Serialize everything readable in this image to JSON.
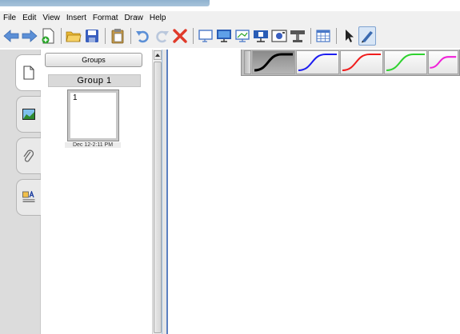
{
  "menu": {
    "items": [
      "File",
      "Edit",
      "View",
      "Insert",
      "Format",
      "Draw",
      "Help"
    ]
  },
  "toolbar": {
    "icons": [
      "back-arrow-icon",
      "forward-arrow-icon",
      "new-page-icon",
      "open-folder-icon",
      "save-icon",
      "clipboard-icon",
      "undo-icon",
      "redo-icon",
      "delete-icon",
      "screen-icon",
      "monitor-icon",
      "display-icon",
      "projector-icon",
      "camera-icon",
      "scanner-icon",
      "table-icon",
      "select-arrow-icon",
      "pen-icon"
    ]
  },
  "sidebar": {
    "tabs": [
      "page-sorter-tab",
      "gallery-tab",
      "attachments-tab",
      "properties-tab"
    ]
  },
  "panel": {
    "groups_button": "Groups",
    "group_header": "Group 1",
    "thumbnail": {
      "number": "1",
      "caption": "Dec 12-2:11 PM"
    }
  },
  "pens": {
    "colors": [
      "#000000",
      "#1d1df0",
      "#f01d1d",
      "#2fd22f",
      "#f020d8"
    ]
  }
}
